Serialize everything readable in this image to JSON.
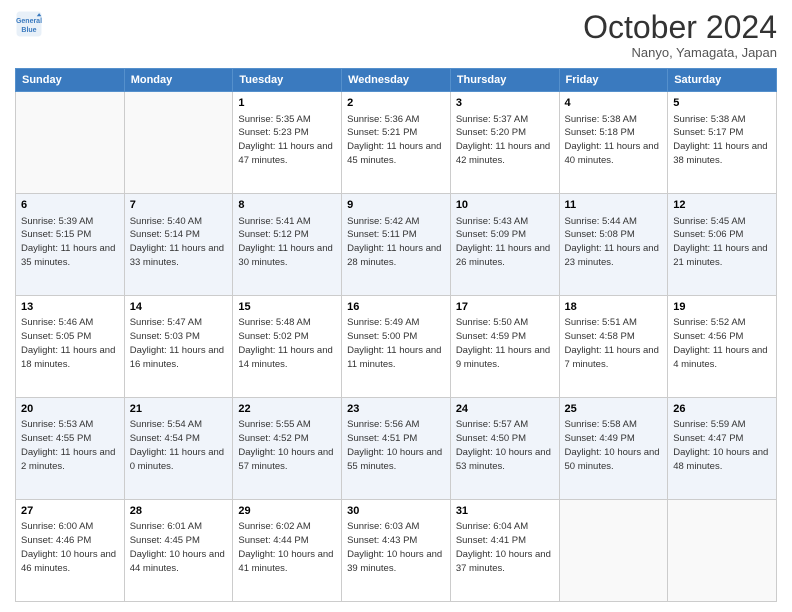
{
  "header": {
    "logo_line1": "General",
    "logo_line2": "Blue",
    "month": "October 2024",
    "location": "Nanyo, Yamagata, Japan"
  },
  "weekdays": [
    "Sunday",
    "Monday",
    "Tuesday",
    "Wednesday",
    "Thursday",
    "Friday",
    "Saturday"
  ],
  "weeks": [
    [
      {
        "day": "",
        "info": ""
      },
      {
        "day": "",
        "info": ""
      },
      {
        "day": "1",
        "info": "Sunrise: 5:35 AM\nSunset: 5:23 PM\nDaylight: 11 hours and 47 minutes."
      },
      {
        "day": "2",
        "info": "Sunrise: 5:36 AM\nSunset: 5:21 PM\nDaylight: 11 hours and 45 minutes."
      },
      {
        "day": "3",
        "info": "Sunrise: 5:37 AM\nSunset: 5:20 PM\nDaylight: 11 hours and 42 minutes."
      },
      {
        "day": "4",
        "info": "Sunrise: 5:38 AM\nSunset: 5:18 PM\nDaylight: 11 hours and 40 minutes."
      },
      {
        "day": "5",
        "info": "Sunrise: 5:38 AM\nSunset: 5:17 PM\nDaylight: 11 hours and 38 minutes."
      }
    ],
    [
      {
        "day": "6",
        "info": "Sunrise: 5:39 AM\nSunset: 5:15 PM\nDaylight: 11 hours and 35 minutes."
      },
      {
        "day": "7",
        "info": "Sunrise: 5:40 AM\nSunset: 5:14 PM\nDaylight: 11 hours and 33 minutes."
      },
      {
        "day": "8",
        "info": "Sunrise: 5:41 AM\nSunset: 5:12 PM\nDaylight: 11 hours and 30 minutes."
      },
      {
        "day": "9",
        "info": "Sunrise: 5:42 AM\nSunset: 5:11 PM\nDaylight: 11 hours and 28 minutes."
      },
      {
        "day": "10",
        "info": "Sunrise: 5:43 AM\nSunset: 5:09 PM\nDaylight: 11 hours and 26 minutes."
      },
      {
        "day": "11",
        "info": "Sunrise: 5:44 AM\nSunset: 5:08 PM\nDaylight: 11 hours and 23 minutes."
      },
      {
        "day": "12",
        "info": "Sunrise: 5:45 AM\nSunset: 5:06 PM\nDaylight: 11 hours and 21 minutes."
      }
    ],
    [
      {
        "day": "13",
        "info": "Sunrise: 5:46 AM\nSunset: 5:05 PM\nDaylight: 11 hours and 18 minutes."
      },
      {
        "day": "14",
        "info": "Sunrise: 5:47 AM\nSunset: 5:03 PM\nDaylight: 11 hours and 16 minutes."
      },
      {
        "day": "15",
        "info": "Sunrise: 5:48 AM\nSunset: 5:02 PM\nDaylight: 11 hours and 14 minutes."
      },
      {
        "day": "16",
        "info": "Sunrise: 5:49 AM\nSunset: 5:00 PM\nDaylight: 11 hours and 11 minutes."
      },
      {
        "day": "17",
        "info": "Sunrise: 5:50 AM\nSunset: 4:59 PM\nDaylight: 11 hours and 9 minutes."
      },
      {
        "day": "18",
        "info": "Sunrise: 5:51 AM\nSunset: 4:58 PM\nDaylight: 11 hours and 7 minutes."
      },
      {
        "day": "19",
        "info": "Sunrise: 5:52 AM\nSunset: 4:56 PM\nDaylight: 11 hours and 4 minutes."
      }
    ],
    [
      {
        "day": "20",
        "info": "Sunrise: 5:53 AM\nSunset: 4:55 PM\nDaylight: 11 hours and 2 minutes."
      },
      {
        "day": "21",
        "info": "Sunrise: 5:54 AM\nSunset: 4:54 PM\nDaylight: 11 hours and 0 minutes."
      },
      {
        "day": "22",
        "info": "Sunrise: 5:55 AM\nSunset: 4:52 PM\nDaylight: 10 hours and 57 minutes."
      },
      {
        "day": "23",
        "info": "Sunrise: 5:56 AM\nSunset: 4:51 PM\nDaylight: 10 hours and 55 minutes."
      },
      {
        "day": "24",
        "info": "Sunrise: 5:57 AM\nSunset: 4:50 PM\nDaylight: 10 hours and 53 minutes."
      },
      {
        "day": "25",
        "info": "Sunrise: 5:58 AM\nSunset: 4:49 PM\nDaylight: 10 hours and 50 minutes."
      },
      {
        "day": "26",
        "info": "Sunrise: 5:59 AM\nSunset: 4:47 PM\nDaylight: 10 hours and 48 minutes."
      }
    ],
    [
      {
        "day": "27",
        "info": "Sunrise: 6:00 AM\nSunset: 4:46 PM\nDaylight: 10 hours and 46 minutes."
      },
      {
        "day": "28",
        "info": "Sunrise: 6:01 AM\nSunset: 4:45 PM\nDaylight: 10 hours and 44 minutes."
      },
      {
        "day": "29",
        "info": "Sunrise: 6:02 AM\nSunset: 4:44 PM\nDaylight: 10 hours and 41 minutes."
      },
      {
        "day": "30",
        "info": "Sunrise: 6:03 AM\nSunset: 4:43 PM\nDaylight: 10 hours and 39 minutes."
      },
      {
        "day": "31",
        "info": "Sunrise: 6:04 AM\nSunset: 4:41 PM\nDaylight: 10 hours and 37 minutes."
      },
      {
        "day": "",
        "info": ""
      },
      {
        "day": "",
        "info": ""
      }
    ]
  ]
}
